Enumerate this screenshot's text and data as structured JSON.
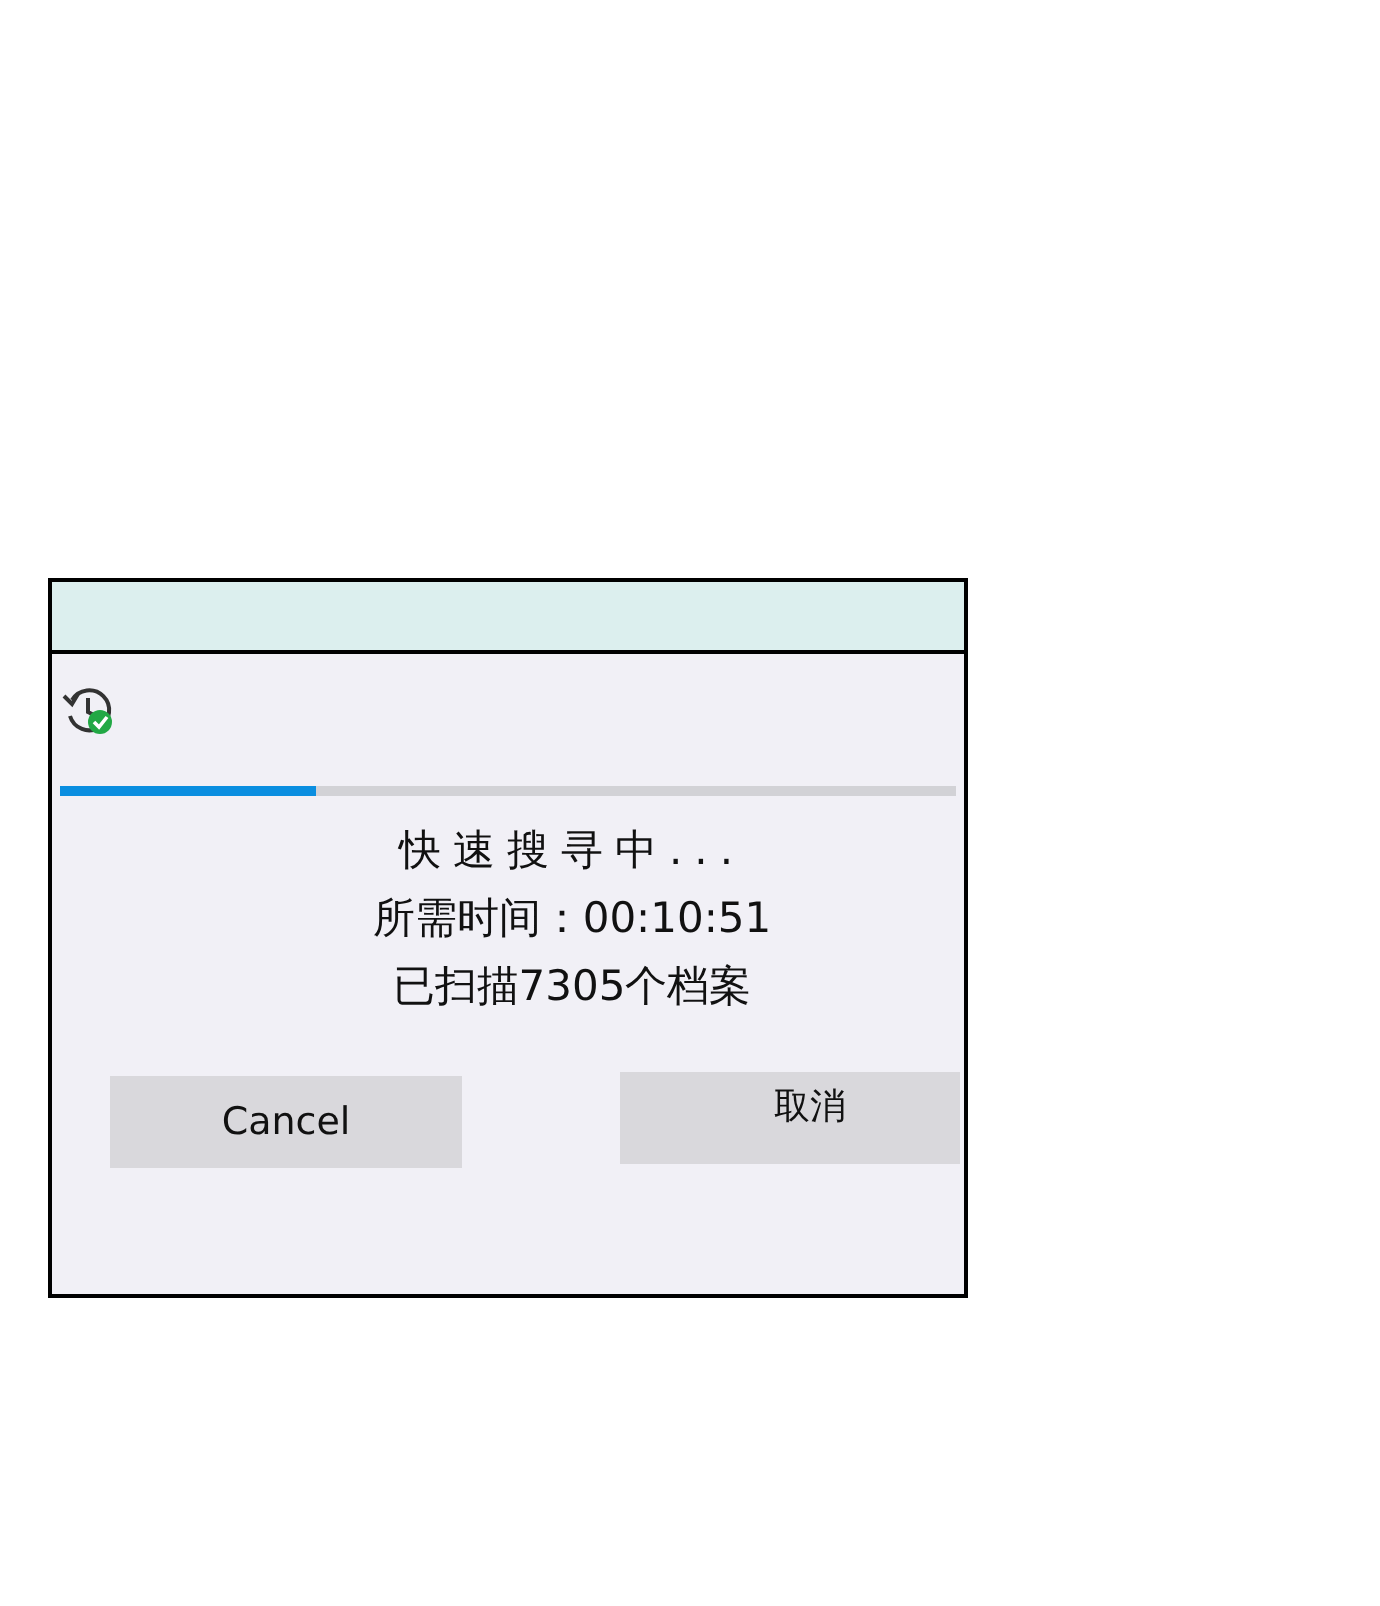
{
  "progress": {
    "level": 0.285
  },
  "status_lines": [
    "快速搜寻中...",
    "所需时间：00:10:51",
    "已扫描7305个档案"
  ],
  "buttons": [
    {
      "label": "Cancel"
    },
    {
      "label": "取消"
    }
  ]
}
